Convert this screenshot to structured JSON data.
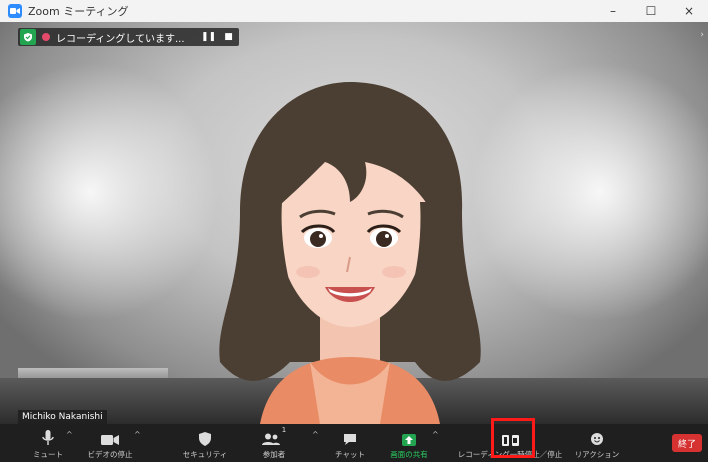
{
  "window": {
    "title": "Zoom ミーティング",
    "controls": {
      "minimize": "–",
      "maximize": "☐",
      "close": "×"
    }
  },
  "recording": {
    "status": "レコーディングしています..."
  },
  "participant": {
    "name": "Michiko Nakanishi"
  },
  "toolbar": {
    "mute": "ミュート",
    "stop_video": "ビデオの停止",
    "security": "セキュリティ",
    "participants": "参加者",
    "participants_count": "1",
    "chat": "チャット",
    "share_screen": "画面の共有",
    "recording": "レコーディング一時停止／停止",
    "reactions": "リアクション",
    "end": "終了"
  },
  "colors": {
    "accent_green": "#23a451",
    "end_red": "#d63232",
    "highlight_red": "#ff1a1a",
    "recording_dot": "#e64a6b"
  },
  "icons": [
    "zoom-app-icon",
    "security-shield-icon",
    "recording-dot-icon",
    "pause-icon",
    "stop-icon",
    "microphone-icon",
    "video-camera-icon",
    "shield-icon",
    "participants-icon",
    "chat-bubble-icon",
    "share-screen-icon",
    "pause-stop-recording-icon",
    "reaction-icon"
  ]
}
